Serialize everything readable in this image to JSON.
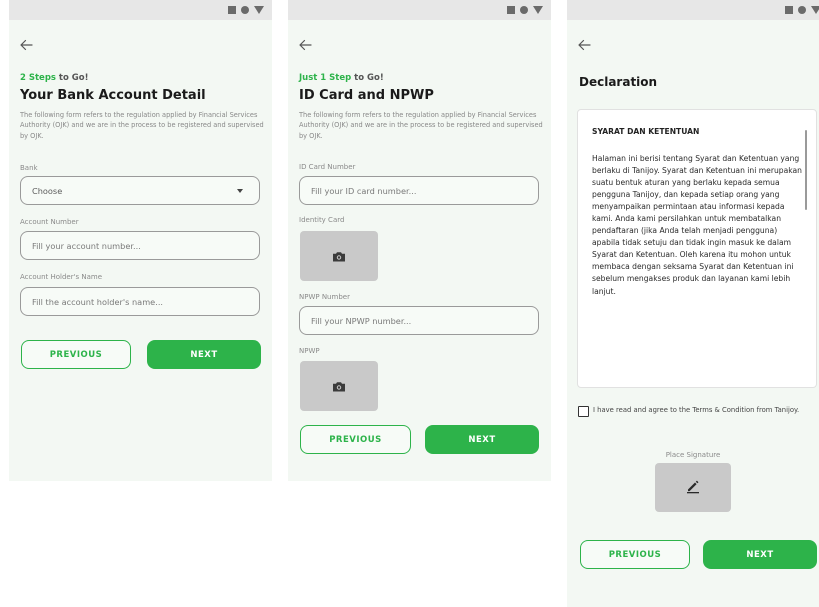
{
  "screens": [
    {
      "step_count": "2 Steps",
      "step_suffix": " to Go!",
      "title": "Your Bank Account Detail",
      "description": "The following form refers to the regulation applied by Financial Services Authority (OJK) and we are in the process to be registered and supervised by OJK.",
      "fields": [
        {
          "label": "Bank",
          "value": "Choose"
        },
        {
          "label": "Account Number",
          "placeholder": "Fill your account number..."
        },
        {
          "label": "Account Holder's Name",
          "placeholder": "Fill the account holder's name..."
        }
      ],
      "prev_label": "PREVIOUS",
      "next_label": "NEXT"
    },
    {
      "step_count": "Just 1 Step",
      "step_suffix": " to Go!",
      "title": "ID Card and NPWP",
      "description": "The following form refers to the regulation applied by Financial Services Authority (OJK) and we are in the process to be registered and supervised by OJK.",
      "fields": [
        {
          "label": "ID Card Number",
          "placeholder": "Fill your ID card number..."
        },
        {
          "label": "Identity Card"
        },
        {
          "label": "NPWP Number",
          "placeholder": "Fill your NPWP number..."
        },
        {
          "label": "NPWP"
        }
      ],
      "prev_label": "PREVIOUS",
      "next_label": "NEXT"
    },
    {
      "title": "Declaration",
      "terms_heading": "SYARAT DAN KETENTUAN",
      "terms_body": "Halaman ini berisi tentang Syarat dan Ketentuan yang berlaku di Tanijoy. Syarat dan Ketentuan ini merupakan suatu bentuk aturan yang berlaku kepada semua pengguna Tanijoy, dan kepada setiap orang yang menyampaikan permintaan atau informasi kepada kami. Anda kami persilahkan untuk membatalkan pendaftaran (jika Anda telah menjadi pengguna) apabila tidak setuju dan tidak ingin masuk ke dalam Syarat dan Ketentuan. Oleh karena itu mohon untuk membaca dengan seksama Syarat dan Ketentuan ini sebelum mengakses produk dan layanan kami lebih lanjut.",
      "agree_text": "I have read and agree to the Terms & Condition from Tanijoy.",
      "signature_label": "Place Signature",
      "prev_label": "PREVIOUS",
      "next_label": "NEXT"
    }
  ],
  "status_icons": [
    "square-icon",
    "circle-icon",
    "triangle-icon"
  ],
  "colors": {
    "accent": "#2db34a",
    "screen_background": "#f3f8f3",
    "statusbar": "#e7e7e7",
    "upload_placeholder": "#c9c9c9"
  }
}
